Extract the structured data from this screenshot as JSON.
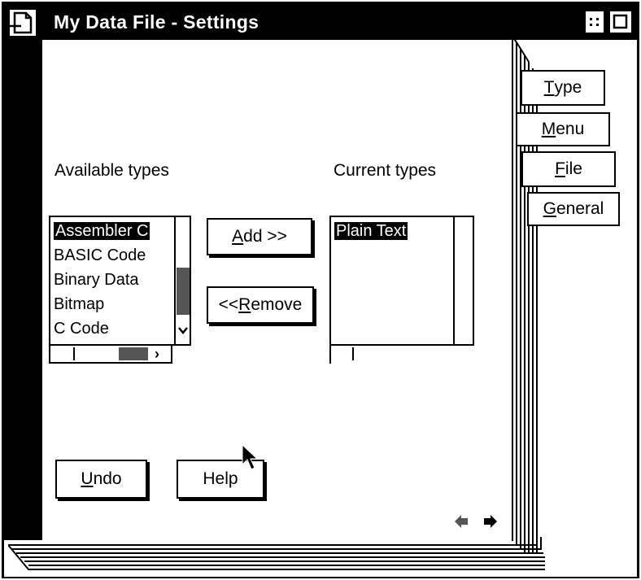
{
  "window": {
    "title": "My Data File - Settings"
  },
  "available": {
    "label": "Available types",
    "items": [
      "Assembler C",
      "BASIC Code",
      "Binary Data",
      "Bitmap",
      "C Code"
    ],
    "selected_index": 0
  },
  "current": {
    "label": "Current types",
    "items": [
      "Plain Text"
    ]
  },
  "buttons": {
    "add_key": "A",
    "add_rest": "dd >>",
    "remove_prefix": "<<",
    "remove_key": "R",
    "remove_rest": "emove",
    "undo_key": "U",
    "undo_rest": "ndo",
    "help": "Help"
  },
  "tabs": [
    {
      "key": "T",
      "rest": "ype"
    },
    {
      "key": "M",
      "rest": "enu"
    },
    {
      "key": "F",
      "rest": "ile"
    },
    {
      "key": "G",
      "rest": "eneral"
    }
  ],
  "icons": {
    "system_menu": "document-icon",
    "minimize": "minimize-icon",
    "maximize": "maximize-icon",
    "page_back": "arrow-left-icon",
    "page_forward": "arrow-right-icon"
  }
}
